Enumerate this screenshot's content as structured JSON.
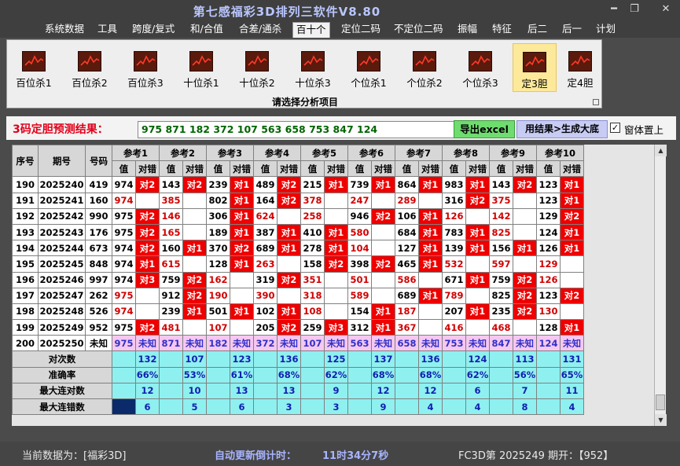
{
  "window": {
    "title": "第七感福彩3D排列三软件V8.80",
    "minimize": "━",
    "restore": "❐",
    "close": "✕"
  },
  "menu": [
    {
      "label": "系统数据",
      "active": false
    },
    {
      "label": "工具",
      "active": false
    },
    {
      "label": "跨度/复式",
      "active": false
    },
    {
      "label": "和/合值",
      "active": false
    },
    {
      "label": "合差/通杀",
      "active": false
    },
    {
      "label": "百十个",
      "active": true
    },
    {
      "label": "定位二码",
      "active": false
    },
    {
      "label": "不定位二码",
      "active": false
    },
    {
      "label": "振幅",
      "active": false
    },
    {
      "label": "特征",
      "active": false
    },
    {
      "label": "后二",
      "active": false
    },
    {
      "label": "后一",
      "active": false
    },
    {
      "label": "计划",
      "active": false
    }
  ],
  "ribbon": {
    "buttons": [
      {
        "label": "百位杀1",
        "icon": "chart-icon",
        "active": false
      },
      {
        "label": "百位杀2",
        "icon": "chart-icon",
        "active": false
      },
      {
        "label": "百位杀3",
        "icon": "chart-icon",
        "active": false
      },
      {
        "label": "十位杀1",
        "icon": "chart-icon",
        "active": false
      },
      {
        "label": "十位杀2",
        "icon": "chart-icon",
        "active": false
      },
      {
        "label": "十位杀3",
        "icon": "chart-icon",
        "active": false
      },
      {
        "label": "个位杀1",
        "icon": "chart-icon",
        "active": false
      },
      {
        "label": "个位杀2",
        "icon": "chart-icon",
        "active": false
      },
      {
        "label": "个位杀3",
        "icon": "chart-icon",
        "active": false
      },
      {
        "label": "定3胆",
        "icon": "chart-icon",
        "active": true
      },
      {
        "label": "定4胆",
        "icon": "chart-icon",
        "active": false
      }
    ],
    "caption": "请选择分析项目"
  },
  "prediction": {
    "label": "3码定胆预测结果：",
    "value": "975 871 182 372 107 563 658 753 847 124",
    "excel_button": "导出excel",
    "generate_button": "用结果>生成大底",
    "pin_checked": true,
    "pin_label": "窗体置上",
    "check_mark": "✓"
  },
  "table": {
    "headers": {
      "seq": "序号",
      "period": "期号",
      "code": "号码",
      "refs": [
        "参考1",
        "参考2",
        "参考3",
        "参考4",
        "参考5",
        "参考6",
        "参考7",
        "参考8",
        "参考9",
        "参考10"
      ],
      "val": "值",
      "right": "对错"
    },
    "rows": [
      {
        "seq": "190",
        "period": "2025240",
        "code": "419",
        "cells": [
          {
            "v": "974",
            "r": "对2"
          },
          {
            "v": "143",
            "r": "对2"
          },
          {
            "v": "239",
            "r": "对1"
          },
          {
            "v": "489",
            "r": "对2"
          },
          {
            "v": "215",
            "r": "对1"
          },
          {
            "v": "739",
            "r": "对1"
          },
          {
            "v": "864",
            "r": "对1"
          },
          {
            "v": "983",
            "r": "对1"
          },
          {
            "v": "143",
            "r": "对2"
          },
          {
            "v": "123",
            "r": "对1"
          }
        ]
      },
      {
        "seq": "191",
        "period": "2025241",
        "code": "160",
        "cells": [
          {
            "v": "974",
            "r": ""
          },
          {
            "v": "385",
            "r": ""
          },
          {
            "v": "802",
            "r": "对1"
          },
          {
            "v": "164",
            "r": "对2"
          },
          {
            "v": "378",
            "r": ""
          },
          {
            "v": "247",
            "r": ""
          },
          {
            "v": "289",
            "r": ""
          },
          {
            "v": "316",
            "r": "对2"
          },
          {
            "v": "375",
            "r": ""
          },
          {
            "v": "123",
            "r": "对1"
          }
        ]
      },
      {
        "seq": "192",
        "period": "2025242",
        "code": "990",
        "cells": [
          {
            "v": "975",
            "r": "对2"
          },
          {
            "v": "146",
            "r": ""
          },
          {
            "v": "306",
            "r": "对1"
          },
          {
            "v": "624",
            "r": ""
          },
          {
            "v": "258",
            "r": ""
          },
          {
            "v": "946",
            "r": "对2"
          },
          {
            "v": "106",
            "r": "对1"
          },
          {
            "v": "126",
            "r": ""
          },
          {
            "v": "142",
            "r": ""
          },
          {
            "v": "129",
            "r": "对2"
          }
        ]
      },
      {
        "seq": "193",
        "period": "2025243",
        "code": "176",
        "cells": [
          {
            "v": "975",
            "r": "对2"
          },
          {
            "v": "165",
            "r": ""
          },
          {
            "v": "189",
            "r": "对1"
          },
          {
            "v": "387",
            "r": "对1"
          },
          {
            "v": "410",
            "r": "对1"
          },
          {
            "v": "580",
            "r": ""
          },
          {
            "v": "684",
            "r": "对1"
          },
          {
            "v": "783",
            "r": "对1"
          },
          {
            "v": "825",
            "r": ""
          },
          {
            "v": "124",
            "r": "对1"
          }
        ]
      },
      {
        "seq": "194",
        "period": "2025244",
        "code": "673",
        "cells": [
          {
            "v": "974",
            "r": "对2"
          },
          {
            "v": "160",
            "r": "对1"
          },
          {
            "v": "370",
            "r": "对2"
          },
          {
            "v": "689",
            "r": "对1"
          },
          {
            "v": "278",
            "r": "对1"
          },
          {
            "v": "104",
            "r": ""
          },
          {
            "v": "127",
            "r": "对1"
          },
          {
            "v": "139",
            "r": "对1"
          },
          {
            "v": "156",
            "r": "对1"
          },
          {
            "v": "126",
            "r": "对1"
          }
        ]
      },
      {
        "seq": "195",
        "period": "2025245",
        "code": "848",
        "cells": [
          {
            "v": "974",
            "r": "对1"
          },
          {
            "v": "615",
            "r": ""
          },
          {
            "v": "128",
            "r": "对1"
          },
          {
            "v": "263",
            "r": ""
          },
          {
            "v": "158",
            "r": "对2"
          },
          {
            "v": "398",
            "r": "对2"
          },
          {
            "v": "465",
            "r": "对1"
          },
          {
            "v": "532",
            "r": ""
          },
          {
            "v": "597",
            "r": ""
          },
          {
            "v": "129",
            "r": ""
          }
        ]
      },
      {
        "seq": "196",
        "period": "2025246",
        "code": "997",
        "cells": [
          {
            "v": "974",
            "r": "对3"
          },
          {
            "v": "759",
            "r": "对2"
          },
          {
            "v": "162",
            "r": ""
          },
          {
            "v": "319",
            "r": "对2"
          },
          {
            "v": "351",
            "r": ""
          },
          {
            "v": "501",
            "r": ""
          },
          {
            "v": "586",
            "r": ""
          },
          {
            "v": "671",
            "r": "对1"
          },
          {
            "v": "759",
            "r": "对2"
          },
          {
            "v": "126",
            "r": ""
          }
        ]
      },
      {
        "seq": "197",
        "period": "2025247",
        "code": "262",
        "cells": [
          {
            "v": "975",
            "r": ""
          },
          {
            "v": "912",
            "r": "对2"
          },
          {
            "v": "190",
            "r": ""
          },
          {
            "v": "390",
            "r": ""
          },
          {
            "v": "318",
            "r": ""
          },
          {
            "v": "589",
            "r": ""
          },
          {
            "v": "689",
            "r": "对1"
          },
          {
            "v": "789",
            "r": ""
          },
          {
            "v": "825",
            "r": "对2"
          },
          {
            "v": "123",
            "r": "对2"
          }
        ]
      },
      {
        "seq": "198",
        "period": "2025248",
        "code": "526",
        "cells": [
          {
            "v": "974",
            "r": ""
          },
          {
            "v": "239",
            "r": "对1"
          },
          {
            "v": "501",
            "r": "对1"
          },
          {
            "v": "102",
            "r": "对1"
          },
          {
            "v": "108",
            "r": ""
          },
          {
            "v": "154",
            "r": "对1"
          },
          {
            "v": "187",
            "r": ""
          },
          {
            "v": "207",
            "r": "对1"
          },
          {
            "v": "235",
            "r": "对2"
          },
          {
            "v": "130",
            "r": ""
          }
        ]
      },
      {
        "seq": "199",
        "period": "2025249",
        "code": "952",
        "cells": [
          {
            "v": "975",
            "r": "对2"
          },
          {
            "v": "481",
            "r": ""
          },
          {
            "v": "107",
            "r": ""
          },
          {
            "v": "205",
            "r": "对2"
          },
          {
            "v": "259",
            "r": "对3"
          },
          {
            "v": "312",
            "r": "对1"
          },
          {
            "v": "367",
            "r": ""
          },
          {
            "v": "416",
            "r": ""
          },
          {
            "v": "468",
            "r": ""
          },
          {
            "v": "128",
            "r": "对1"
          }
        ]
      },
      {
        "seq": "200",
        "period": "2025250",
        "code": "未知",
        "cells": [
          {
            "v": "975",
            "r": "未知"
          },
          {
            "v": "871",
            "r": "未知"
          },
          {
            "v": "182",
            "r": "未知"
          },
          {
            "v": "372",
            "r": "未知"
          },
          {
            "v": "107",
            "r": "未知"
          },
          {
            "v": "563",
            "r": "未知"
          },
          {
            "v": "658",
            "r": "未知"
          },
          {
            "v": "753",
            "r": "未知"
          },
          {
            "v": "847",
            "r": "未知"
          },
          {
            "v": "124",
            "r": "未知"
          }
        ]
      }
    ],
    "stats": [
      {
        "label": "对次数",
        "values": [
          "132",
          "107",
          "123",
          "136",
          "125",
          "137",
          "136",
          "124",
          "113",
          "131"
        ],
        "highlight": false
      },
      {
        "label": "准确率",
        "values": [
          "66%",
          "53%",
          "61%",
          "68%",
          "62%",
          "68%",
          "68%",
          "62%",
          "56%",
          "65%"
        ],
        "highlight": false
      },
      {
        "label": "最大连对数",
        "values": [
          "12",
          "10",
          "13",
          "13",
          "9",
          "12",
          "12",
          "6",
          "7",
          "11"
        ],
        "highlight": false
      },
      {
        "label": "最大连错数",
        "values": [
          "6",
          "5",
          "6",
          "3",
          "3",
          "9",
          "4",
          "4",
          "8",
          "4"
        ],
        "highlight": true
      }
    ]
  },
  "status": {
    "current_data": "当前数据为：[福彩3D]",
    "countdown_label": "自动更新倒计时：",
    "countdown_value": "11时34分7秒",
    "period_info": "FC3D第 2025249 期开：【952】"
  },
  "colors": {
    "hit_bg": "#ee0000",
    "predict_row_bg": "#f6c8f0",
    "stats_bg": "#8ff0f0",
    "excel_button": "#6fdc6f",
    "generate_button": "#c8ccf4",
    "active_ribbon": "#fde99a"
  }
}
